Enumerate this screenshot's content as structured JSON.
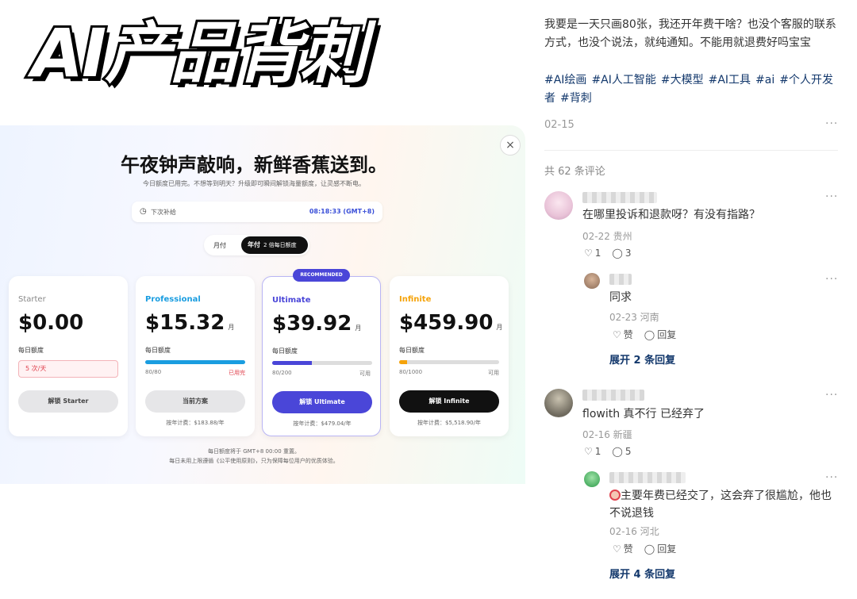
{
  "banner": {
    "title": "AI产品背刺"
  },
  "pricing": {
    "close": "×",
    "title": "午夜钟声敲响，新鲜香蕉送到。",
    "subtitle": "今日额度已用完。不想等到明天？升级即可瞬间解锁海量额度，让灵感不断电。",
    "countdown_label": "下次补给",
    "countdown_value": "08:18:33 (GMT+8)",
    "toggle_monthly": "月付",
    "toggle_annual": "年付",
    "toggle_annual_note": "2 倍每日额度",
    "plans": [
      {
        "name": "Starter",
        "price": "$0.00",
        "unit": "",
        "quota_label": "每日额度",
        "limit": "5 次/天",
        "button": "解锁 Starter"
      },
      {
        "name": "Professional",
        "price": "$15.32",
        "unit": "月",
        "quota_label": "每日额度",
        "count": "80/80",
        "status": "已用完",
        "usage": 1.0,
        "button": "当前方案",
        "annual": "按年计费：$183.88/年"
      },
      {
        "name": "Ultimate",
        "price": "$39.92",
        "unit": "月",
        "quota_label": "每日额度",
        "count": "80/200",
        "status": "可用",
        "usage": 0.4,
        "button": "解锁 Ultimate",
        "annual": "按年计费：$479.04/年",
        "badge": "RECOMMENDED"
      },
      {
        "name": "Infinite",
        "price": "$459.90",
        "unit": "月",
        "quota_label": "每日额度",
        "count": "80/1000",
        "status": "可用",
        "usage": 0.08,
        "button": "解锁 Infinite",
        "annual": "按年计费：$5,518.90/年"
      }
    ],
    "footer1": "每日额度将于 GMT+8 00:00 重置。",
    "footer2": "每日未用上限遵循《公平使用原则》，只为保障每位用户的优质体验。"
  },
  "post": {
    "text": "我要是一天只画80张，我还开年费干啥？也没个客服的联系方式，也没个说法，就纯通知。不能用就退费好吗宝宝",
    "tags": [
      "#AI绘画",
      "#AI人工智能",
      "#大模型",
      "#AI工具",
      "#ai",
      "#个人开发者",
      "#背刺"
    ],
    "date": "02-15",
    "more": "···",
    "comment_count": "共 62 条评论"
  },
  "comments": [
    {
      "text": "在哪里投诉和退款呀？有没有指路？",
      "meta": "02-22 贵州",
      "likes": "1",
      "replies": "3"
    },
    {
      "text": "同求",
      "meta": "02-23 河南",
      "like_label": "赞",
      "reply_label": "回复",
      "expand": "展开 2 条回复"
    },
    {
      "text": "flowith 真不行 已经弃了",
      "meta": "02-16 新疆",
      "likes": "1",
      "replies": "5"
    },
    {
      "text": "主要年费已经交了，这会弃了很尴尬，他也不说退钱",
      "meta": "02-16 河北",
      "like_label": "赞",
      "reply_label": "回复",
      "expand": "展开 4 条回复"
    }
  ],
  "colors": {
    "accent": "#13386c",
    "ultimate": "#4a46d8",
    "professional": "#1a9de0",
    "infinite": "#f5a30a",
    "starter_red": "#e0434f"
  }
}
